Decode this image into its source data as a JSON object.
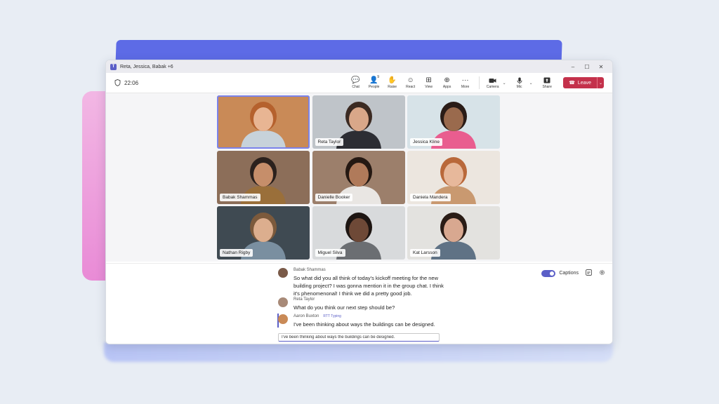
{
  "window": {
    "title": "Reta, Jessica, Babak +6"
  },
  "window_controls": {
    "minimize": "–",
    "maximize": "☐",
    "close": "✕"
  },
  "meeting": {
    "timer": "22:06"
  },
  "toolbar": {
    "buttons": [
      {
        "label": "Chat",
        "icon": "chat-icon",
        "glyph": "💬"
      },
      {
        "label": "People",
        "icon": "people-icon",
        "glyph": "👤",
        "count": "9"
      },
      {
        "label": "Raise",
        "icon": "hand-icon",
        "glyph": "✋"
      },
      {
        "label": "React",
        "icon": "smile-icon",
        "glyph": "☺"
      },
      {
        "label": "View",
        "icon": "grid-icon",
        "glyph": "⊞"
      },
      {
        "label": "Apps",
        "icon": "apps-icon",
        "glyph": "⊕"
      },
      {
        "label": "More",
        "icon": "more-icon",
        "glyph": "···"
      }
    ],
    "camera_label": "Camera",
    "mic_label": "Mic",
    "share_label": "Share",
    "leave_label": "Leave"
  },
  "participants": [
    {
      "name": "",
      "bg": "#c98a57",
      "skin": "#e8b593",
      "hair": "#b5612d",
      "shirt": "#c7d2da"
    },
    {
      "name": "Reta Taylor",
      "bg": "#bfc4c9",
      "skin": "#d9a789",
      "hair": "#3b2a22",
      "shirt": "#2c2d33"
    },
    {
      "name": "Jessica Kline",
      "bg": "#d7e3e8",
      "skin": "#9a6a4d",
      "hair": "#2a1c17",
      "shirt": "#e95d8f"
    },
    {
      "name": "Babak Shammas",
      "bg": "#8c6e59",
      "skin": "#c68e6a",
      "hair": "#2b211d",
      "shirt": "#9a6f3a"
    },
    {
      "name": "Danielle Booker",
      "bg": "#9c7f6b",
      "skin": "#b07a5a",
      "hair": "#241812",
      "shirt": "#e9e6e3"
    },
    {
      "name": "Daniela Mandera",
      "bg": "#ece6df",
      "skin": "#e7b89b",
      "hair": "#b9683a",
      "shirt": "#c99970"
    },
    {
      "name": "Nathan Rigby",
      "bg": "#3f4a52",
      "skin": "#dcae8e",
      "hair": "#7c5a3c",
      "shirt": "#7a8fa0"
    },
    {
      "name": "Miguel Silva",
      "bg": "#d8dadc",
      "skin": "#6e4937",
      "hair": "#1d1512",
      "shirt": "#6b6e72"
    },
    {
      "name": "Kat Larsson",
      "bg": "#e3e2df",
      "skin": "#d8a890",
      "hair": "#2a1c16",
      "shirt": "#5f7285"
    }
  ],
  "captions": {
    "toggle_label": "Captions",
    "messages": [
      {
        "author": "Babak Shammas",
        "text": "So what did you all think of today's kickoff meeting for the new building project? I was gonna mention it in the group chat. I think it's phenomenonal! I think we did a pretty good job.",
        "avatar_color": "#7a5a48"
      },
      {
        "author": "Reta Taylor",
        "text": "What do you think our next step should be?",
        "avatar_color": "#a88a78"
      },
      {
        "author": "Aaron Buxton",
        "badge": "RTT Typing",
        "text": "I've been thinking about ways the buildings can be designed.",
        "avatar_color": "#c98a57"
      }
    ],
    "rtt_input_value": "I've been thinking about ways the buildings can be designed."
  }
}
